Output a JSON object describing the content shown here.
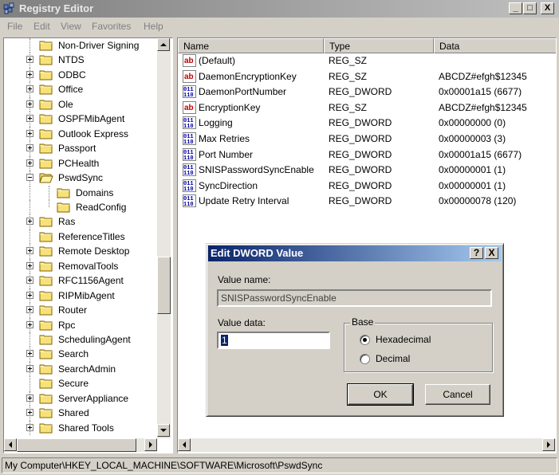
{
  "window": {
    "title": "Registry Editor"
  },
  "menu": [
    "File",
    "Edit",
    "View",
    "Favorites",
    "Help"
  ],
  "tree": {
    "items": [
      {
        "label": "Non-Driver Signing",
        "expander": "none",
        "indent": 0
      },
      {
        "label": "NTDS",
        "expander": "plus",
        "indent": 0
      },
      {
        "label": "ODBC",
        "expander": "plus",
        "indent": 0
      },
      {
        "label": "Office",
        "expander": "plus",
        "indent": 0
      },
      {
        "label": "Ole",
        "expander": "plus",
        "indent": 0
      },
      {
        "label": "OSPFMibAgent",
        "expander": "plus",
        "indent": 0
      },
      {
        "label": "Outlook Express",
        "expander": "plus",
        "indent": 0
      },
      {
        "label": "Passport",
        "expander": "plus",
        "indent": 0
      },
      {
        "label": "PCHealth",
        "expander": "plus",
        "indent": 0
      },
      {
        "label": "PswdSync",
        "expander": "minus",
        "indent": 0,
        "open": true
      },
      {
        "label": "Domains",
        "expander": "none",
        "indent": 1
      },
      {
        "label": "ReadConfig",
        "expander": "none",
        "indent": 1
      },
      {
        "label": "Ras",
        "expander": "plus",
        "indent": 0
      },
      {
        "label": "ReferenceTitles",
        "expander": "none",
        "indent": 0
      },
      {
        "label": "Remote Desktop",
        "expander": "plus",
        "indent": 0
      },
      {
        "label": "RemovalTools",
        "expander": "plus",
        "indent": 0
      },
      {
        "label": "RFC1156Agent",
        "expander": "plus",
        "indent": 0
      },
      {
        "label": "RIPMibAgent",
        "expander": "plus",
        "indent": 0
      },
      {
        "label": "Router",
        "expander": "plus",
        "indent": 0
      },
      {
        "label": "Rpc",
        "expander": "plus",
        "indent": 0
      },
      {
        "label": "SchedulingAgent",
        "expander": "none",
        "indent": 0
      },
      {
        "label": "Search",
        "expander": "plus",
        "indent": 0
      },
      {
        "label": "SearchAdmin",
        "expander": "plus",
        "indent": 0
      },
      {
        "label": "Secure",
        "expander": "none",
        "indent": 0
      },
      {
        "label": "ServerAppliance",
        "expander": "plus",
        "indent": 0
      },
      {
        "label": "Shared",
        "expander": "plus",
        "indent": 0
      },
      {
        "label": "Shared Tools",
        "expander": "plus",
        "indent": 0
      }
    ]
  },
  "list": {
    "columns": [
      "Name",
      "Type",
      "Data"
    ],
    "rows": [
      {
        "name": "(Default)",
        "type": "REG_SZ",
        "data": "",
        "icon": "string-value-icon"
      },
      {
        "name": "DaemonEncryptionKey",
        "type": "REG_SZ",
        "data": "ABCDZ#efgh$12345",
        "icon": "string-value-icon"
      },
      {
        "name": "DaemonPortNumber",
        "type": "REG_DWORD",
        "data": "0x00001a15 (6677)",
        "icon": "binary-value-icon"
      },
      {
        "name": "EncryptionKey",
        "type": "REG_SZ",
        "data": "ABCDZ#efgh$12345",
        "icon": "string-value-icon"
      },
      {
        "name": "Logging",
        "type": "REG_DWORD",
        "data": "0x00000000 (0)",
        "icon": "binary-value-icon"
      },
      {
        "name": "Max Retries",
        "type": "REG_DWORD",
        "data": "0x00000003 (3)",
        "icon": "binary-value-icon"
      },
      {
        "name": "Port Number",
        "type": "REG_DWORD",
        "data": "0x00001a15 (6677)",
        "icon": "binary-value-icon"
      },
      {
        "name": "SNISPasswordSyncEnable",
        "type": "REG_DWORD",
        "data": "0x00000001 (1)",
        "icon": "binary-value-icon"
      },
      {
        "name": "SyncDirection",
        "type": "REG_DWORD",
        "data": "0x00000001 (1)",
        "icon": "binary-value-icon"
      },
      {
        "name": "Update Retry Interval",
        "type": "REG_DWORD",
        "data": "0x00000078 (120)",
        "icon": "binary-value-icon"
      }
    ]
  },
  "status": "My Computer\\HKEY_LOCAL_MACHINE\\SOFTWARE\\Microsoft\\PswdSync",
  "dialog": {
    "title": "Edit DWORD Value",
    "help_btn": "?",
    "close_btn": "X",
    "value_name_label": "Value name:",
    "value_name": "SNISPasswordSyncEnable",
    "value_data_label": "Value data:",
    "value_data": "1",
    "base_label": "Base",
    "hex_label": "Hexadecimal",
    "dec_label": "Decimal",
    "selected_base": "Hexadecimal",
    "ok_label": "OK",
    "cancel_label": "Cancel"
  },
  "titlebar_buttons": {
    "minimize": "_",
    "maximize": "□",
    "close": "X"
  }
}
